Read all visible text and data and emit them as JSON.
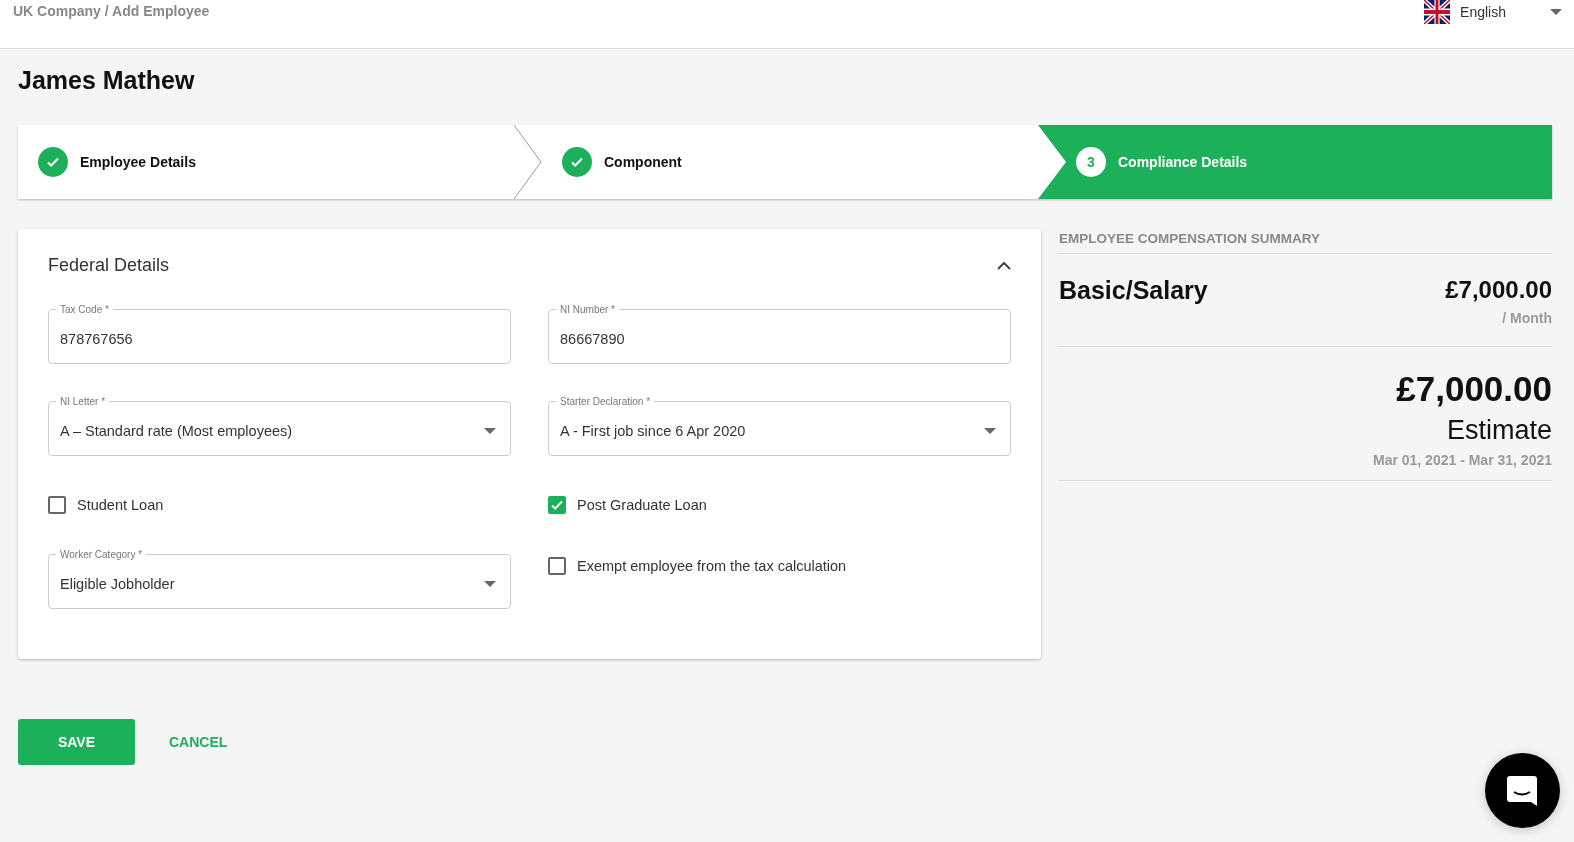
{
  "header": {
    "breadcrumb": "UK Company / Add Employee",
    "language": "English"
  },
  "page_title": "James Mathew",
  "steps": [
    {
      "label": "Employee Details",
      "completed": true,
      "selected": false
    },
    {
      "label": "Component",
      "completed": true,
      "selected": false
    },
    {
      "number": "3",
      "label": "Compliance Details",
      "completed": false,
      "selected": true
    }
  ],
  "section": {
    "title": "Federal Details",
    "expanded": true,
    "items": [
      {
        "kind": "text",
        "label": "Tax Code *",
        "value": "878767656"
      },
      {
        "kind": "text",
        "label": "NI Number *",
        "value": "86667890"
      },
      {
        "kind": "select",
        "label": "NI Letter *",
        "value": "A – Standard rate (Most employees)"
      },
      {
        "kind": "select",
        "label": "Starter Declaration *",
        "value": "A - First job since 6 Apr 2020"
      },
      {
        "kind": "checkbox",
        "label": "Student Loan",
        "checked": false
      },
      {
        "kind": "checkbox",
        "label": "Post Graduate Loan",
        "checked": true
      },
      {
        "kind": "select",
        "label": "Worker Category *",
        "value": "Eligible Jobholder"
      },
      {
        "kind": "checkbox",
        "label": "Exempt employee from the tax calculation",
        "checked": false
      }
    ]
  },
  "summary": {
    "heading": "EMPLOYEE COMPENSATION SUMMARY",
    "component": "Basic/Salary",
    "amount": "£7,000.00",
    "period": "/ Month",
    "total": "£7,000.00",
    "total_label": "Estimate",
    "date_range": "Mar 01, 2021 - Mar 31, 2021"
  },
  "buttons": {
    "save": "SAVE",
    "cancel": "CANCEL"
  }
}
